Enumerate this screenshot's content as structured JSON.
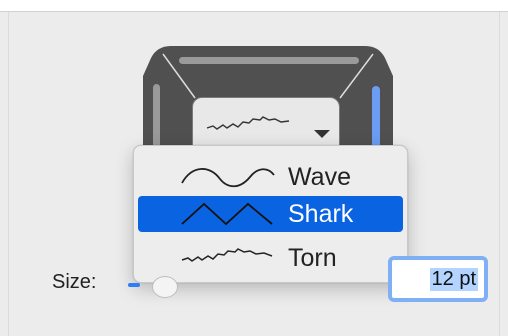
{
  "menu": {
    "items": [
      {
        "label": "Wave",
        "icon": "wave-edge-icon",
        "selected": false
      },
      {
        "label": "Shark",
        "icon": "shark-edge-icon",
        "selected": true
      },
      {
        "label": "Torn",
        "icon": "torn-edge-icon",
        "selected": false
      }
    ]
  },
  "size": {
    "label": "Size:",
    "value": "12 pt"
  },
  "colors": {
    "accent": "#0a63e0",
    "focus_ring": "#7fb0f6",
    "frame": "#4f4f4f",
    "active_side": "#6a9df3"
  }
}
